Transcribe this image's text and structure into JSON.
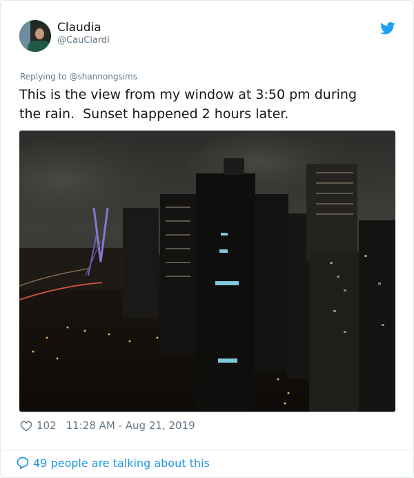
{
  "tweet": {
    "author_name": "Claudia",
    "author_handle": "@CauCiardi",
    "replying_prefix": "Replying to ",
    "replying_to": "@shannongsims",
    "text": "This is the view from my window at 3:50 pm during\nthe rain.  Sunset happened 2 hours later.",
    "likes": "102",
    "timestamp": "11:28 AM - Aug 21, 2019",
    "conversation": "49 people are talking about this"
  },
  "colors": {
    "twitter_blue": "#1da1f2",
    "link_blue": "#1b95e0",
    "muted": "#657786"
  },
  "icons": {
    "brand": "twitter-bird-icon",
    "like": "heart-icon",
    "reply": "speech-bubble-icon"
  }
}
